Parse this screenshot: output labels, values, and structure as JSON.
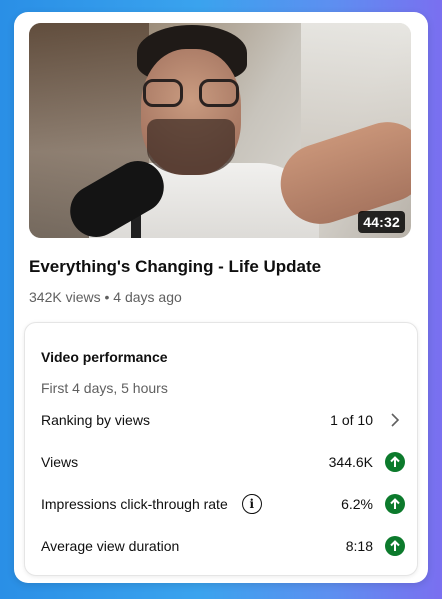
{
  "video": {
    "duration": "44:32",
    "title": "Everything's Changing - Life Update",
    "meta": "342K views • 4 days ago"
  },
  "performance": {
    "heading": "Video performance",
    "period": "First 4 days, 5 hours",
    "ranking": {
      "label": "Ranking by views",
      "value": "1 of 10"
    },
    "views": {
      "label": "Views",
      "value": "344.6K",
      "trend": "up"
    },
    "ctr": {
      "label": "Impressions click-through rate",
      "value": "6.2%",
      "trend": "up"
    },
    "avg_duration": {
      "label": "Average view duration",
      "value": "8:18",
      "trend": "up"
    }
  },
  "colors": {
    "trend_up": "#0c7a2c",
    "text_primary": "#0f0f0f",
    "text_secondary": "#606060"
  },
  "icons": [
    "info-icon",
    "chevron-right-icon",
    "arrow-up-icon"
  ]
}
